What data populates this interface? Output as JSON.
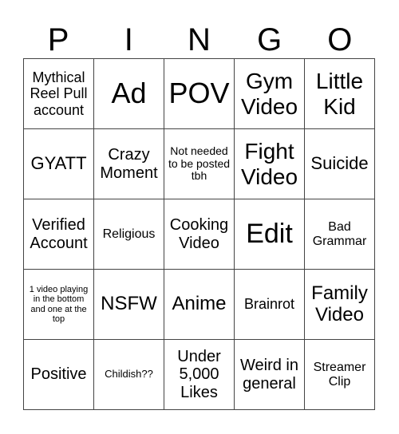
{
  "header": {
    "letters": [
      "P",
      "I",
      "N",
      "G",
      "O"
    ]
  },
  "cells": [
    "Mythical Reel Pull account",
    "Ad",
    "POV",
    "Gym Video",
    "Little Kid",
    "GYATT",
    "Crazy Moment",
    "Not needed to be posted tbh",
    "Fight Video",
    "Suicide",
    "Verified Account",
    "Religious",
    "Cooking Video",
    "Edit",
    "Bad Grammar",
    "1 video playing in the bottom and one at the top",
    "NSFW",
    "Anime",
    "Brainrot",
    "Family Video",
    "Positive",
    "Childish??",
    "Under 5,000 Likes",
    "Weird in general",
    "Streamer Clip"
  ]
}
